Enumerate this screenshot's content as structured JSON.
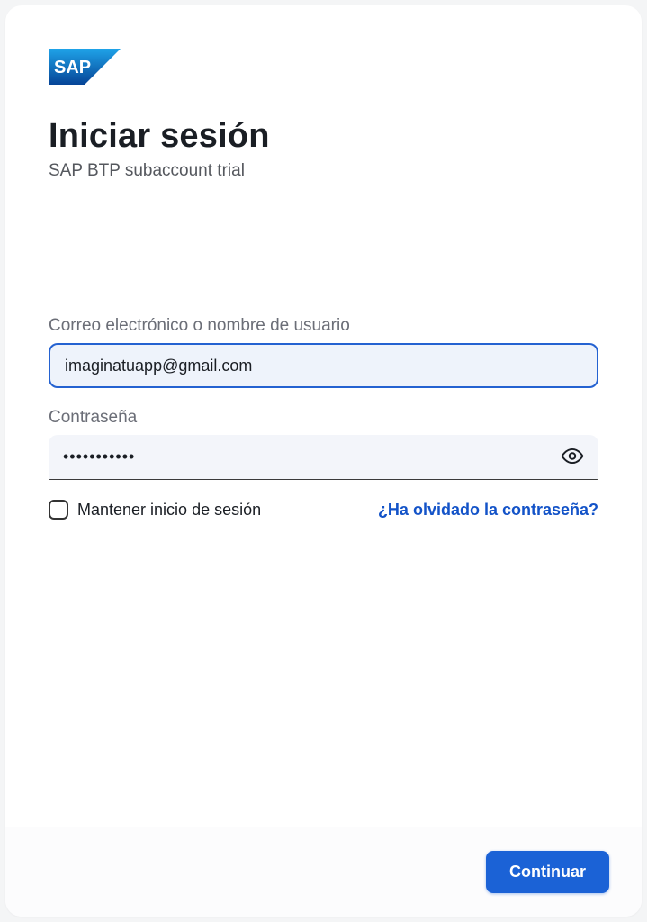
{
  "brand": "SAP",
  "page_title": "Iniciar sesión",
  "subtitle": "SAP BTP subaccount trial",
  "fields": {
    "email": {
      "label": "Correo electrónico o nombre de usuario",
      "value": "imaginatuapp@gmail.com"
    },
    "password": {
      "label": "Contraseña",
      "value": "•••••••••••"
    }
  },
  "remember_label": "Mantener inicio de sesión",
  "forgot_label": "¿Ha olvidado la contraseña?",
  "continue_label": "Continuar",
  "colors": {
    "primary": "#1b62d6",
    "link": "#1353c8"
  }
}
